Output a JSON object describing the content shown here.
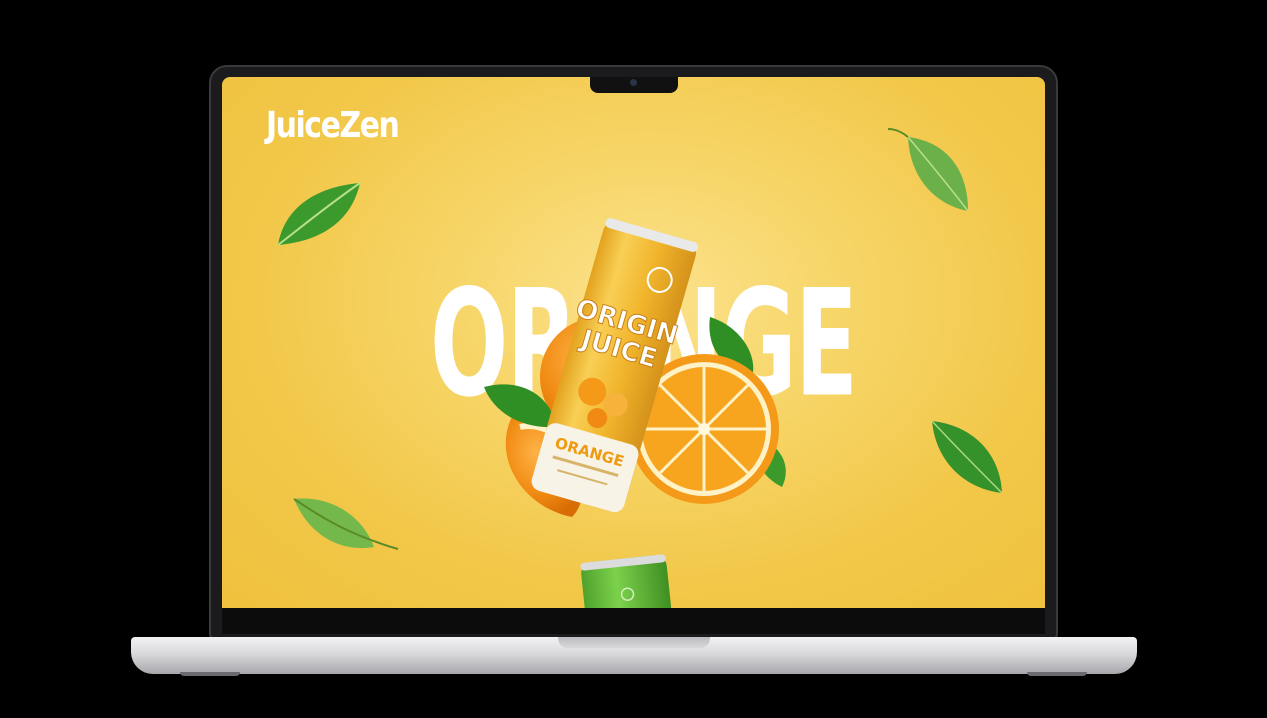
{
  "brand": {
    "logo_text": "JuiceZen"
  },
  "hero": {
    "word": "ORANGE"
  },
  "product": {
    "can_badge": "ORIGIN JUICE",
    "can_title_line1": "ORIGIN",
    "can_title_line2": "JUICE",
    "can_flavor": "ORANGE"
  },
  "colors": {
    "background": "#f2c84a",
    "text": "#ffffff",
    "can": "#f1b52c",
    "leaf": "#3d9a2a"
  },
  "icons": {
    "leaves": [
      "leaf-icon",
      "leaf-icon",
      "leaf-icon",
      "leaf-icon"
    ],
    "fruit": "orange-slice-icon"
  }
}
